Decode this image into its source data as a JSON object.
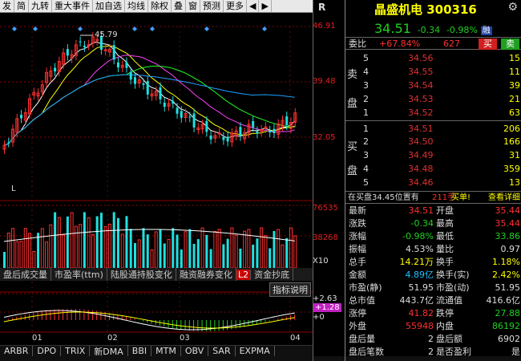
{
  "toolbar": {
    "items": [
      "发",
      "简",
      "九转",
      "重大事件",
      "加自选",
      "均线",
      "除权",
      "叠",
      "窗",
      "预测",
      "更多"
    ]
  },
  "chart": {
    "price_axis": [
      "46.91",
      "39.48",
      "32.05"
    ],
    "high_marker": "45.79",
    "low_marker": "L",
    "volume_axis": [
      "76535",
      "38268",
      "X10"
    ],
    "macd_axis": [
      "+2.63",
      "+1.28",
      "+0"
    ],
    "x_labels": [
      "01",
      "02",
      "03",
      "04"
    ]
  },
  "subtabs": [
    "盘后成交量",
    "市盈率(ttm)",
    "陆股通持股变化",
    "融资融券变化",
    "L2",
    "资金抄底"
  ],
  "indicator_help": "指标说明",
  "bottom_tabs": [
    "ARBR",
    "DPO",
    "TRIX",
    "新DMA",
    "BBI",
    "MTM",
    "OBV",
    "SAR",
    "EXPMA"
  ],
  "right": {
    "r_label": "R",
    "name": "晶盛机电",
    "code": "300316",
    "gear_icon": "gear-icon",
    "price": "34.51",
    "change": "-0.34",
    "change_pct": "-0.98%",
    "badge": "融",
    "weibi_label": "委比",
    "weibi_value": "+67.84%",
    "weicha_value": "627",
    "buy_btn": "买",
    "sell_btn": "卖",
    "sell_side_label": [
      "卖",
      "盘"
    ],
    "buy_side_label": [
      "买",
      "盘"
    ],
    "asks": [
      {
        "lvl": "5",
        "price": "34.56",
        "vol": "15"
      },
      {
        "lvl": "4",
        "price": "34.55",
        "vol": "11"
      },
      {
        "lvl": "3",
        "price": "34.54",
        "vol": "39"
      },
      {
        "lvl": "2",
        "price": "34.53",
        "vol": "21"
      },
      {
        "lvl": "1",
        "price": "34.52",
        "vol": "63"
      }
    ],
    "bids": [
      {
        "lvl": "1",
        "price": "34.51",
        "vol": "206"
      },
      {
        "lvl": "2",
        "price": "34.50",
        "vol": "166"
      },
      {
        "lvl": "3",
        "price": "34.49",
        "vol": "31"
      },
      {
        "lvl": "4",
        "price": "34.48",
        "vol": "359"
      },
      {
        "lvl": "5",
        "price": "34.46",
        "vol": "13"
      }
    ],
    "notice_prefix": "在买盘34.45位置有",
    "notice_qty": "211手",
    "notice_action": "买单!",
    "notice_link": "查看详细",
    "stats": [
      {
        "k": "最新",
        "v": "34.51",
        "vc": "red",
        "k2": "开盘",
        "v2": "35.44",
        "v2c": "red"
      },
      {
        "k": "涨跌",
        "v": "-0.34",
        "vc": "green",
        "k2": "最高",
        "v2": "35.44",
        "v2c": "red"
      },
      {
        "k": "涨幅",
        "v": "-0.98%",
        "vc": "green",
        "k2": "最低",
        "v2": "33.86",
        "v2c": "green"
      },
      {
        "k": "振幅",
        "v": "4.53%",
        "vc": "white",
        "k2": "量比",
        "v2": "0.97",
        "v2c": "white"
      },
      {
        "k": "总手",
        "v": "14.21万",
        "vc": "yellow",
        "k2": "换手",
        "v2": "1.18%",
        "v2c": "yellow"
      },
      {
        "k": "金额",
        "v": "4.89亿",
        "vc": "cyan",
        "k2": "换手(实)",
        "v2": "2.42%",
        "v2c": "yellow"
      },
      {
        "k": "市盈(静)",
        "v": "51.95",
        "vc": "white",
        "k2": "市盈(动)",
        "v2": "51.95",
        "v2c": "white"
      },
      {
        "k": "总市值",
        "v": "443.7亿",
        "vc": "white",
        "k2": "流通值",
        "v2": "416.6亿",
        "v2c": "white"
      },
      {
        "k": "涨停",
        "v": "41.82",
        "vc": "red",
        "k2": "跌停",
        "v2": "27.88",
        "v2c": "green"
      },
      {
        "k": "外盘",
        "v": "55948",
        "vc": "red",
        "k2": "内盘",
        "v2": "86192",
        "v2c": "green"
      },
      {
        "k": "盘后量",
        "v": "2",
        "vc": "white",
        "k2": "盘后额",
        "v2": "6902",
        "v2c": "white"
      },
      {
        "k": "盘后笔数",
        "v": "2",
        "vc": "white",
        "k2": "是否盈利",
        "v2": "是",
        "v2c": "white"
      }
    ]
  }
}
